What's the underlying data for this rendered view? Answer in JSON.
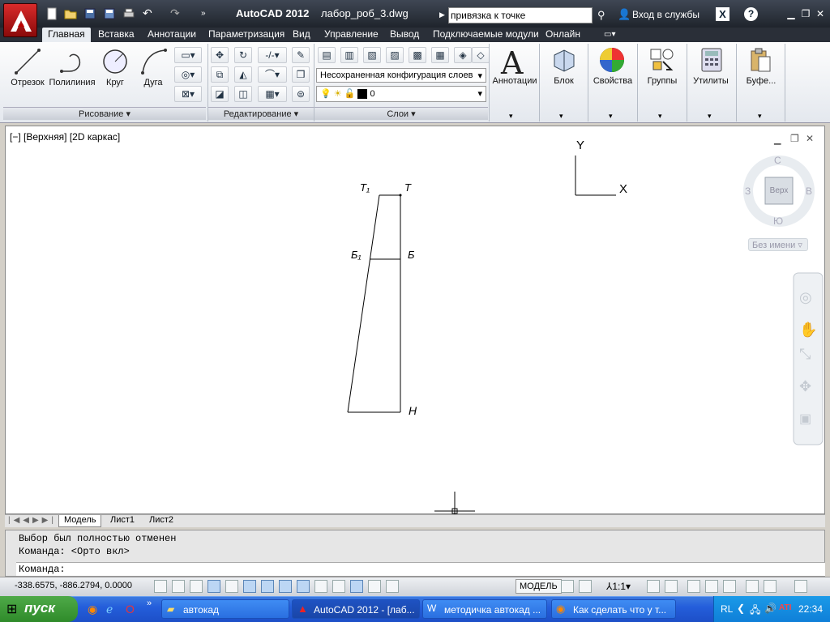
{
  "window": {
    "app_title": "AutoCAD 2012",
    "file_name": "лабор_роб_3.dwg",
    "search_value": "привязка к точке",
    "login_label": "Вход в службы",
    "help_label": "?"
  },
  "ribbon_tabs": [
    "Главная",
    "Вставка",
    "Аннотации",
    "Параметризация",
    "Вид",
    "Управление",
    "Вывод",
    "Подключаемые модули",
    "Онлайн"
  ],
  "ribbon": {
    "draw": {
      "tools": [
        "Отрезок",
        "Полилиния",
        "Круг",
        "Дуга"
      ],
      "panel_title": "Рисование"
    },
    "modify": {
      "panel_title": "Редактирование"
    },
    "layers": {
      "config": "Несохраненная конфигурация слоев",
      "current_layer": "0",
      "panel_title": "Слои"
    },
    "big_buttons": [
      "Аннотации",
      "Блок",
      "Свойства",
      "Группы",
      "Утилиты",
      "Буфе..."
    ]
  },
  "viewport": {
    "label": "[−] [Верхняя] [2D каркас]",
    "ucs_x": "X",
    "ucs_y": "Y",
    "drawing_labels": {
      "t1": "Т₁",
      "t": "Т",
      "b1": "Б₁",
      "b": "Б",
      "n": "Н"
    },
    "viewcube": {
      "north": "С",
      "south": "Ю",
      "west": "З",
      "east": "В",
      "face": "Верх",
      "name": "Без имени"
    }
  },
  "layout_tabs": [
    "Модель",
    "Лист1",
    "Лист2"
  ],
  "command": {
    "history": [
      "Выбор был полностью отменен",
      "Команда:  <Орто вкл>"
    ],
    "prompt": "Команда:"
  },
  "status": {
    "coords": "-338.6575, -886.2794, 0.0000",
    "model_label": "МОДЕЛЬ",
    "scale": "1:1"
  },
  "taskbar": {
    "start_label": "пуск",
    "tasks": [
      "автокад",
      "AutoCAD 2012 - [лаб...",
      "методичка автокад ...",
      "Как сделать что у т..."
    ],
    "lang": "RL",
    "clock": "22:34"
  },
  "colors": {
    "accent_red": "#c0141c",
    "xp_blue": "#245edb",
    "start_green": "#3c9a35"
  }
}
